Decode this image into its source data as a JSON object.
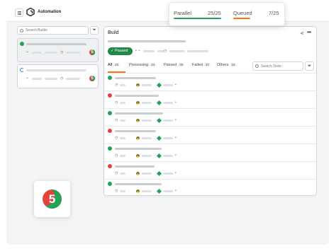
{
  "app": {
    "title": "Automation",
    "logo_icon": "hexagon-logo-icon",
    "menu_icon": "menu-icon"
  },
  "popover": {
    "parallel_label": "Parallel",
    "parallel_value": "25/25",
    "queued_label": "Queued",
    "queued_value": "7/25",
    "colors": {
      "parallel": "#22a355",
      "queued": "#f97316"
    }
  },
  "sidebar": {
    "search_placeholder": "Search Builds",
    "filter_icon": "filter-icon",
    "builds": [
      {
        "status": "passed",
        "status_icon": "check-circle-icon",
        "badge": "5"
      },
      {
        "status": "running",
        "status_icon": "spinner-icon",
        "badge": "5"
      }
    ]
  },
  "main": {
    "title": "Build",
    "share_icon": "share-icon",
    "more_icon": "more-horizontal-icon",
    "status_badge": "Passed",
    "tabs": [
      {
        "label": "All",
        "count": "20"
      },
      {
        "label": "Processing",
        "count": "24"
      },
      {
        "label": "Passed",
        "count": "05"
      },
      {
        "label": "Failed",
        "count": "37"
      },
      {
        "label": "Others",
        "count": "15"
      }
    ],
    "search_placeholder": "Search Tests",
    "tests": [
      {
        "status": "passed"
      },
      {
        "status": "failed"
      },
      {
        "status": "passed"
      },
      {
        "status": "failed"
      },
      {
        "status": "passed"
      },
      {
        "status": "failed"
      },
      {
        "status": "passed"
      }
    ]
  },
  "floating_badge": {
    "value": "5"
  },
  "colors": {
    "passed": "#22a355",
    "failed": "#e0443a",
    "accent": "#f97316",
    "badge_green": "#1f8a45"
  }
}
